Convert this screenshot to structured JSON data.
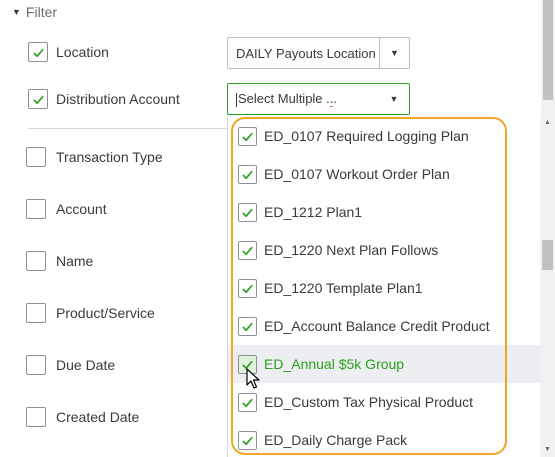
{
  "filter": {
    "header": "Filter",
    "fields": [
      {
        "label": "Location",
        "checked": true
      },
      {
        "label": "Distribution Account",
        "checked": true
      },
      {
        "label": "Transaction Type",
        "checked": false
      },
      {
        "label": "Account",
        "checked": false
      },
      {
        "label": "Name",
        "checked": false
      },
      {
        "label": "Product/Service",
        "checked": false
      },
      {
        "label": "Due Date",
        "checked": false
      },
      {
        "label": "Created Date",
        "checked": false
      }
    ]
  },
  "location_select": {
    "value": "DAILY Payouts Location"
  },
  "distribution_select": {
    "value_prefix": "Select Multiple ",
    "value_suffix": "..."
  },
  "dropdown": {
    "items": [
      {
        "label": "ED_0107 Required Logging Plan",
        "checked": true
      },
      {
        "label": "ED_0107 Workout Order Plan",
        "checked": true
      },
      {
        "label": "ED_1212 Plan1",
        "checked": true
      },
      {
        "label": "ED_1220 Next Plan Follows",
        "checked": true
      },
      {
        "label": "ED_1220 Template Plan1",
        "checked": true
      },
      {
        "label": "ED_Account Balance Credit Product",
        "checked": true
      },
      {
        "label": "ED_Annual $5k Group",
        "checked": true,
        "hovered": true
      },
      {
        "label": "ED_Custom Tax Physical Product",
        "checked": true
      },
      {
        "label": "ED_Daily Charge Pack",
        "checked": true
      }
    ]
  },
  "colors": {
    "accent": "#2ca01c",
    "highlight": "#f2a623",
    "text": "#393a3d"
  }
}
